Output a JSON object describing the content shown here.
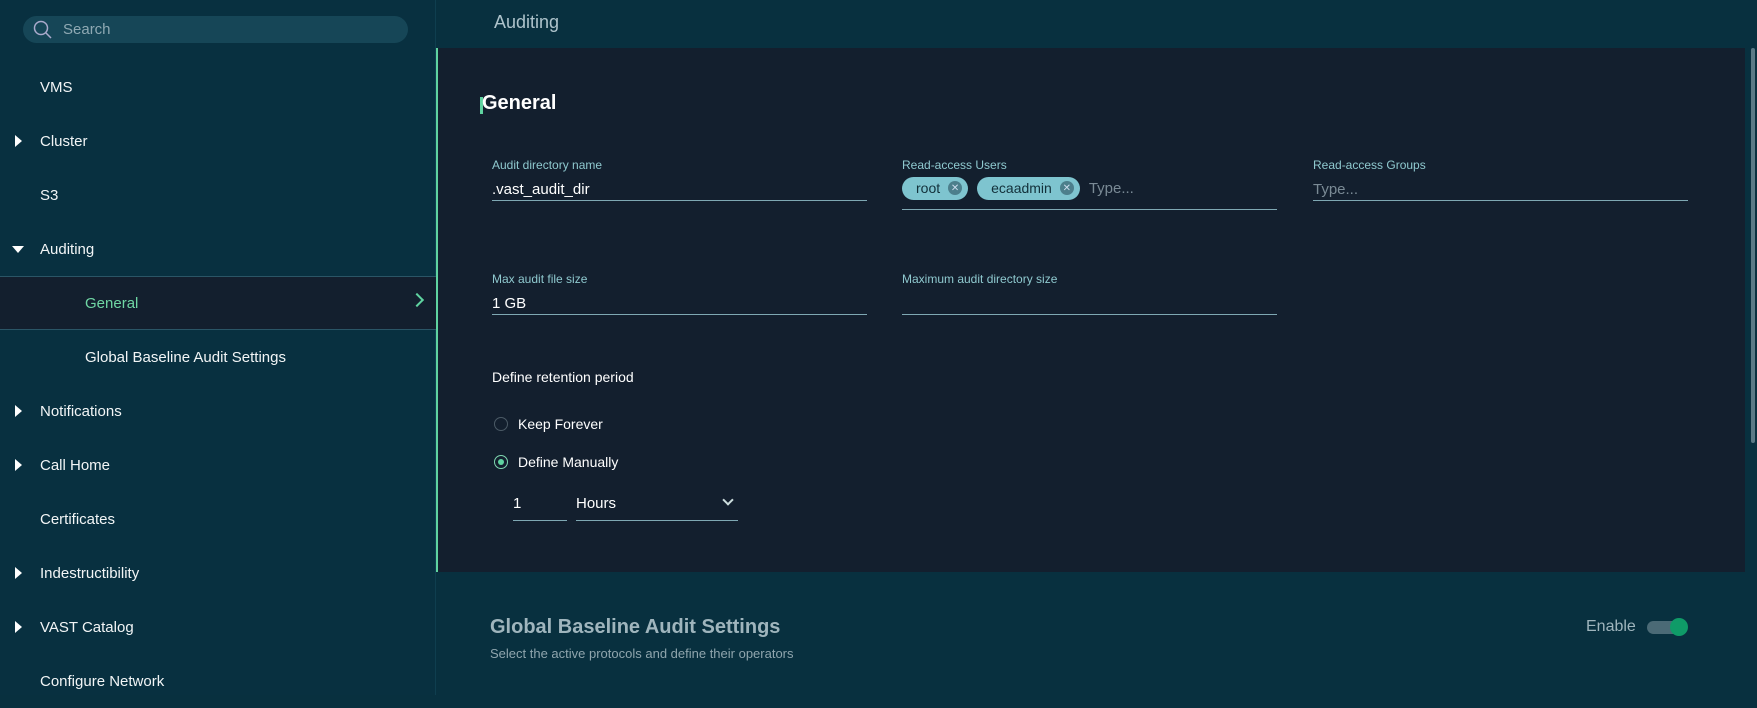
{
  "search": {
    "placeholder": "Search"
  },
  "header": {
    "title": "Auditing"
  },
  "sidebar": {
    "items": [
      {
        "label": "VMS",
        "arrow": "none"
      },
      {
        "label": "Cluster",
        "arrow": "right"
      },
      {
        "label": "S3",
        "arrow": "none"
      },
      {
        "label": "Auditing",
        "arrow": "down"
      },
      {
        "label": "General",
        "child": true,
        "selected": true
      },
      {
        "label": "Global Baseline Audit Settings",
        "child": true
      },
      {
        "label": "Notifications",
        "arrow": "right"
      },
      {
        "label": "Call Home",
        "arrow": "right"
      },
      {
        "label": "Certificates",
        "arrow": "none"
      },
      {
        "label": "Indestructibility",
        "arrow": "right"
      },
      {
        "label": "VAST Catalog",
        "arrow": "right"
      },
      {
        "label": "Configure Network",
        "arrow": "none"
      }
    ]
  },
  "general": {
    "title": "General",
    "audit_dir": {
      "label": "Audit directory name",
      "value": ".vast_audit_dir"
    },
    "users": {
      "label": "Read-access Users",
      "chips": [
        "root",
        "ecaadmin"
      ],
      "placeholder": "Type..."
    },
    "groups": {
      "label": "Read-access Groups",
      "placeholder": "Type..."
    },
    "max_file": {
      "label": "Max audit file size",
      "value": "1 GB"
    },
    "max_dir": {
      "label": "Maximum audit directory size",
      "value": ""
    },
    "retention": {
      "label": "Define retention period",
      "options": [
        "Keep Forever",
        "Define Manually"
      ],
      "selected": "Define Manually",
      "amount": "1",
      "unit": "Hours"
    }
  },
  "baseline": {
    "title": "Global Baseline Audit Settings",
    "subtitle": "Select the active protocols and define their operators",
    "enable_label": "Enable",
    "enabled": true
  },
  "colors": {
    "accent": "#5fd3a0",
    "sidebar": "#083040",
    "panel": "#131f2e",
    "label": "#8fc9cf",
    "chip": "#7ec4cf"
  }
}
